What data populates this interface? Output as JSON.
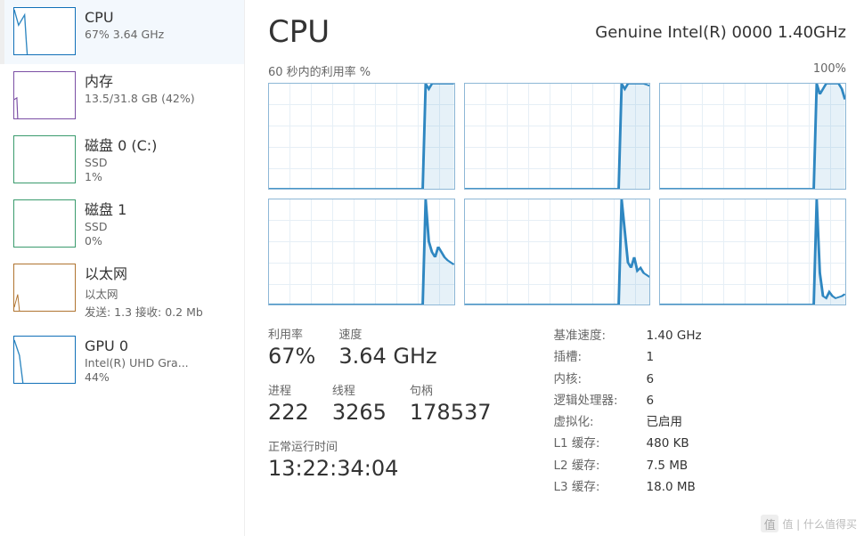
{
  "sidebar": {
    "items": [
      {
        "title": "CPU",
        "sub1": "67%  3.64 GHz",
        "sub2": ""
      },
      {
        "title": "内存",
        "sub1": "13.5/31.8 GB (42%)",
        "sub2": ""
      },
      {
        "title": "磁盘 0 (C:)",
        "sub1": "SSD",
        "sub2": "1%"
      },
      {
        "title": "磁盘 1",
        "sub1": "SSD",
        "sub2": "0%"
      },
      {
        "title": "以太网",
        "sub1": "以太网",
        "sub2": "发送: 1.3  接收: 0.2 Mb"
      },
      {
        "title": "GPU 0",
        "sub1": "Intel(R) UHD Gra...",
        "sub2": "44%"
      }
    ]
  },
  "main": {
    "title": "CPU",
    "model": "Genuine Intel(R) 0000 1.40GHz",
    "axis_label": "60 秒内的利用率 %",
    "axis_max": "100%"
  },
  "stats": {
    "util_label": "利用率",
    "util_value": "67%",
    "speed_label": "速度",
    "speed_value": "3.64 GHz",
    "proc_label": "进程",
    "proc_value": "222",
    "thread_label": "线程",
    "thread_value": "3265",
    "handle_label": "句柄",
    "handle_value": "178537",
    "uptime_label": "正常运行时间",
    "uptime_value": "13:22:34:04"
  },
  "specs": {
    "rows": [
      {
        "k": "基准速度:",
        "v": "1.40 GHz"
      },
      {
        "k": "插槽:",
        "v": "1"
      },
      {
        "k": "内核:",
        "v": "6"
      },
      {
        "k": "逻辑处理器:",
        "v": "6"
      },
      {
        "k": "虚拟化:",
        "v": "已启用"
      },
      {
        "k": "L1 缓存:",
        "v": "480 KB"
      },
      {
        "k": "L2 缓存:",
        "v": "7.5 MB"
      },
      {
        "k": "L3 缓存:",
        "v": "18.0 MB"
      }
    ]
  },
  "watermark": "值 | 什么值得买",
  "chart_data": [
    {
      "type": "area",
      "ylim": [
        0,
        100
      ],
      "xrange": "60s",
      "title": "Core 0",
      "values": [
        0,
        0,
        0,
        0,
        0,
        0,
        0,
        0,
        0,
        0,
        0,
        0,
        0,
        0,
        0,
        0,
        0,
        0,
        0,
        0,
        0,
        0,
        0,
        0,
        0,
        0,
        0,
        0,
        0,
        0,
        0,
        0,
        0,
        0,
        0,
        0,
        0,
        0,
        0,
        0,
        0,
        0,
        0,
        0,
        0,
        0,
        0,
        0,
        0,
        0,
        100,
        95,
        100,
        100,
        100,
        100,
        100,
        100,
        100,
        100
      ]
    },
    {
      "type": "area",
      "ylim": [
        0,
        100
      ],
      "xrange": "60s",
      "title": "Core 1",
      "values": [
        0,
        0,
        0,
        0,
        0,
        0,
        0,
        0,
        0,
        0,
        0,
        0,
        0,
        0,
        0,
        0,
        0,
        0,
        0,
        0,
        0,
        0,
        0,
        0,
        0,
        0,
        0,
        0,
        0,
        0,
        0,
        0,
        0,
        0,
        0,
        0,
        0,
        0,
        0,
        0,
        0,
        0,
        0,
        0,
        0,
        0,
        0,
        0,
        0,
        0,
        100,
        95,
        100,
        100,
        100,
        100,
        100,
        100,
        99,
        98
      ]
    },
    {
      "type": "area",
      "ylim": [
        0,
        100
      ],
      "xrange": "60s",
      "title": "Core 2",
      "values": [
        0,
        0,
        0,
        0,
        0,
        0,
        0,
        0,
        0,
        0,
        0,
        0,
        0,
        0,
        0,
        0,
        0,
        0,
        0,
        0,
        0,
        0,
        0,
        0,
        0,
        0,
        0,
        0,
        0,
        0,
        0,
        0,
        0,
        0,
        0,
        0,
        0,
        0,
        0,
        0,
        0,
        0,
        0,
        0,
        0,
        0,
        0,
        0,
        0,
        0,
        100,
        90,
        95,
        100,
        100,
        100,
        100,
        100,
        95,
        85
      ]
    },
    {
      "type": "area",
      "ylim": [
        0,
        100
      ],
      "xrange": "60s",
      "title": "Core 3",
      "values": [
        0,
        0,
        0,
        0,
        0,
        0,
        0,
        0,
        0,
        0,
        0,
        0,
        0,
        0,
        0,
        0,
        0,
        0,
        0,
        0,
        0,
        0,
        0,
        0,
        0,
        0,
        0,
        0,
        0,
        0,
        0,
        0,
        0,
        0,
        0,
        0,
        0,
        0,
        0,
        0,
        0,
        0,
        0,
        0,
        0,
        0,
        0,
        0,
        0,
        0,
        100,
        60,
        50,
        45,
        55,
        50,
        45,
        42,
        40,
        38
      ]
    },
    {
      "type": "area",
      "ylim": [
        0,
        100
      ],
      "xrange": "60s",
      "title": "Core 4",
      "values": [
        0,
        0,
        0,
        0,
        0,
        0,
        0,
        0,
        0,
        0,
        0,
        0,
        0,
        0,
        0,
        0,
        0,
        0,
        0,
        0,
        0,
        0,
        0,
        0,
        0,
        0,
        0,
        0,
        0,
        0,
        0,
        0,
        0,
        0,
        0,
        0,
        0,
        0,
        0,
        0,
        0,
        0,
        0,
        0,
        0,
        0,
        0,
        0,
        0,
        0,
        100,
        70,
        40,
        35,
        45,
        32,
        35,
        30,
        28,
        26
      ]
    },
    {
      "type": "area",
      "ylim": [
        0,
        100
      ],
      "xrange": "60s",
      "title": "Core 5",
      "values": [
        0,
        0,
        0,
        0,
        0,
        0,
        0,
        0,
        0,
        0,
        0,
        0,
        0,
        0,
        0,
        0,
        0,
        0,
        0,
        0,
        0,
        0,
        0,
        0,
        0,
        0,
        0,
        0,
        0,
        0,
        0,
        0,
        0,
        0,
        0,
        0,
        0,
        0,
        0,
        0,
        0,
        0,
        0,
        0,
        0,
        0,
        0,
        0,
        0,
        0,
        100,
        30,
        8,
        6,
        12,
        8,
        6,
        7,
        8,
        10
      ]
    }
  ]
}
